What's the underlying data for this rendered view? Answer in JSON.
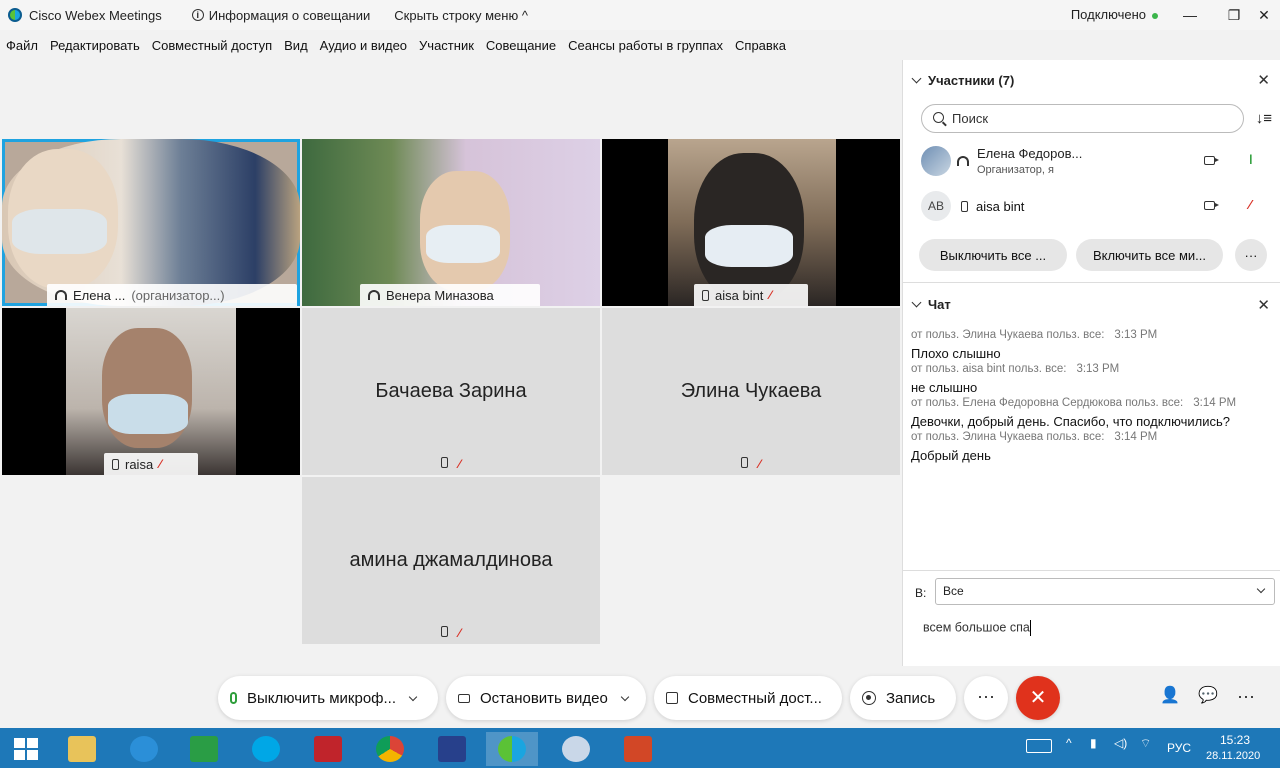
{
  "window": {
    "app_title": "Cisco Webex Meetings",
    "meeting_info": "Информация о совещании",
    "hide_menu": "Скрыть строку меню ^",
    "status": "Подключено",
    "win_min": "—",
    "win_max": "❐",
    "win_close": "✕"
  },
  "menu": [
    "Файл",
    "Редактировать",
    "Совместный доступ",
    "Вид",
    "Аудио и видео",
    "Участник",
    "Совещание",
    "Сеансы работы в группах",
    "Справка"
  ],
  "tiles": {
    "t1": {
      "name": "Елена ...",
      "role": "(организатор...)"
    },
    "t2": {
      "name": "Венера Миназова"
    },
    "t3": {
      "name": "aisa bint"
    },
    "t4": {
      "name": "raisa"
    },
    "t5": {
      "name": "Бачаева Зарина"
    },
    "t6": {
      "name": "Элина Чукаева"
    },
    "t7": {
      "name": "амина джамалдинова"
    }
  },
  "participants": {
    "title": "Участники (7)",
    "search_placeholder": "Поиск",
    "list": [
      {
        "name": "Елена Федоров...",
        "sub": "Организатор, я"
      },
      {
        "initials": "AB",
        "name": "aisa bint"
      }
    ],
    "mute_all": "Выключить все ...",
    "unmute_all": "Включить все ми...",
    "more": "···"
  },
  "chat": {
    "title": "Чат",
    "messages": [
      {
        "meta": "от польз. Элина Чукаева польз. все:",
        "time": "3:13 PM",
        "text": "Плохо слышно"
      },
      {
        "meta": "от польз. aisa bint польз. все:",
        "time": "3:13 PM",
        "text": "не слышно"
      },
      {
        "meta": "от польз. Елена Федоровна Сердюкова польз. все:",
        "time": "3:14 PM",
        "text": "Девочки, добрый день. Спасибо, что подключились?"
      },
      {
        "meta": "от польз. Элина Чукаева польз. все:",
        "time": "3:14 PM",
        "text": "Добрый день"
      }
    ],
    "to_label": "В:",
    "to_value": "Все",
    "input_text": "всем большое спа"
  },
  "controls": {
    "mute": "Выключить микроф...",
    "video": "Остановить видео",
    "share": "Совместный дост...",
    "record": "Запись",
    "more": "···",
    "end": "✕",
    "participants_icon": "👤",
    "chat_icon": "💬",
    "menu_more": "···"
  },
  "taskbar": {
    "lang": "РУС",
    "time": "15:23",
    "date": "28.11.2020"
  },
  "colors": {
    "accent": "#1fa3e0",
    "end_call": "#e0321c",
    "taskbar": "#1e78b8",
    "mic_on": "#2e9e3b",
    "mic_off": "#d93025"
  }
}
